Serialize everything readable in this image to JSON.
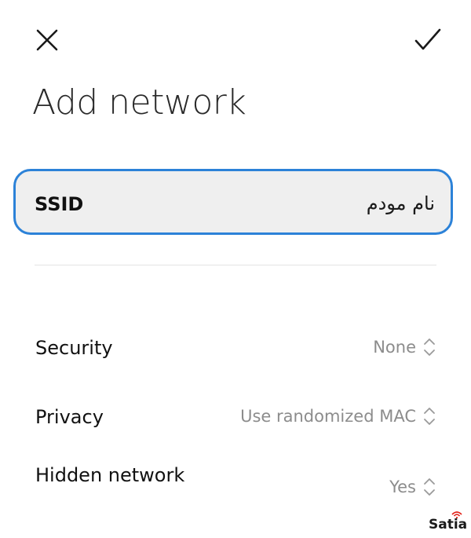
{
  "header": {
    "close_icon": "close-icon",
    "confirm_icon": "checkmark-icon",
    "title": "Add network"
  },
  "ssid": {
    "label": "SSID",
    "value": "نام مودم",
    "focus_color": "#2c82d8"
  },
  "settings": {
    "security": {
      "label": "Security",
      "value": "None",
      "icon": "updown-chevron-icon"
    },
    "privacy": {
      "label": "Privacy",
      "value": "Use randomized MAC",
      "icon": "updown-chevron-icon"
    },
    "hidden_network": {
      "label": "Hidden network",
      "value": "Yes",
      "icon": "updown-chevron-icon"
    }
  },
  "watermark": {
    "text": "Satia",
    "accent_color": "#e2231a"
  }
}
